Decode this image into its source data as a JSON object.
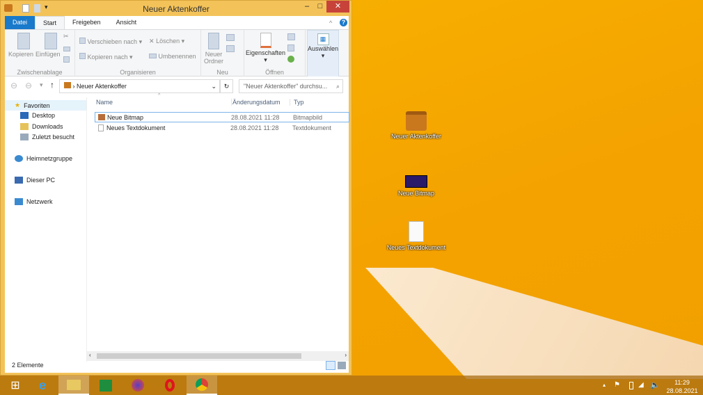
{
  "window": {
    "title": "Neuer Aktenkoffer",
    "minimize": "–",
    "maximize": "□",
    "close": "✕"
  },
  "tabs": [
    "Datei",
    "Start",
    "Freigeben",
    "Ansicht"
  ],
  "ribbon": {
    "kopieren": "Kopieren",
    "einfuegen": "Einfügen",
    "zwischenablage": "Zwischenablage",
    "verschieben": "Verschieben nach ▾",
    "kopieren_nach": "Kopieren nach ▾",
    "loeschen": "Löschen ▾",
    "umbenennen": "Umbenennen",
    "organisieren": "Organisieren",
    "neuer_ordner": "Neuer Ordner",
    "neu": "Neu",
    "eigenschaften": "Eigenschaften",
    "oeffnen": "Öffnen",
    "auswaehlen": "Auswählen"
  },
  "address": {
    "path": "Neuer Aktenkoffer",
    "search_placeholder": "\"Neuer Aktenkoffer\" durchsu..."
  },
  "nav": {
    "favoriten": "Favoriten",
    "desktop": "Desktop",
    "downloads": "Downloads",
    "zuletzt": "Zuletzt besucht",
    "heimnetz": "Heimnetzgruppe",
    "pc": "Dieser PC",
    "netzwerk": "Netzwerk"
  },
  "columns": {
    "name": "Name",
    "date": "Änderungsdatum",
    "type": "Typ"
  },
  "files": [
    {
      "name": "Neue Bitmap",
      "date": "28.08.2021 11:28",
      "type": "Bitmapbild"
    },
    {
      "name": "Neues Textdokument",
      "date": "28.08.2021 11:28",
      "type": "Textdokument"
    }
  ],
  "status": "2 Elemente",
  "desktop_icons": [
    "Neuer Aktenkoffer",
    "Neue Bitmap",
    "Neues Textdokument"
  ],
  "clock": {
    "time": "11:29",
    "date": "28.08.2021"
  }
}
